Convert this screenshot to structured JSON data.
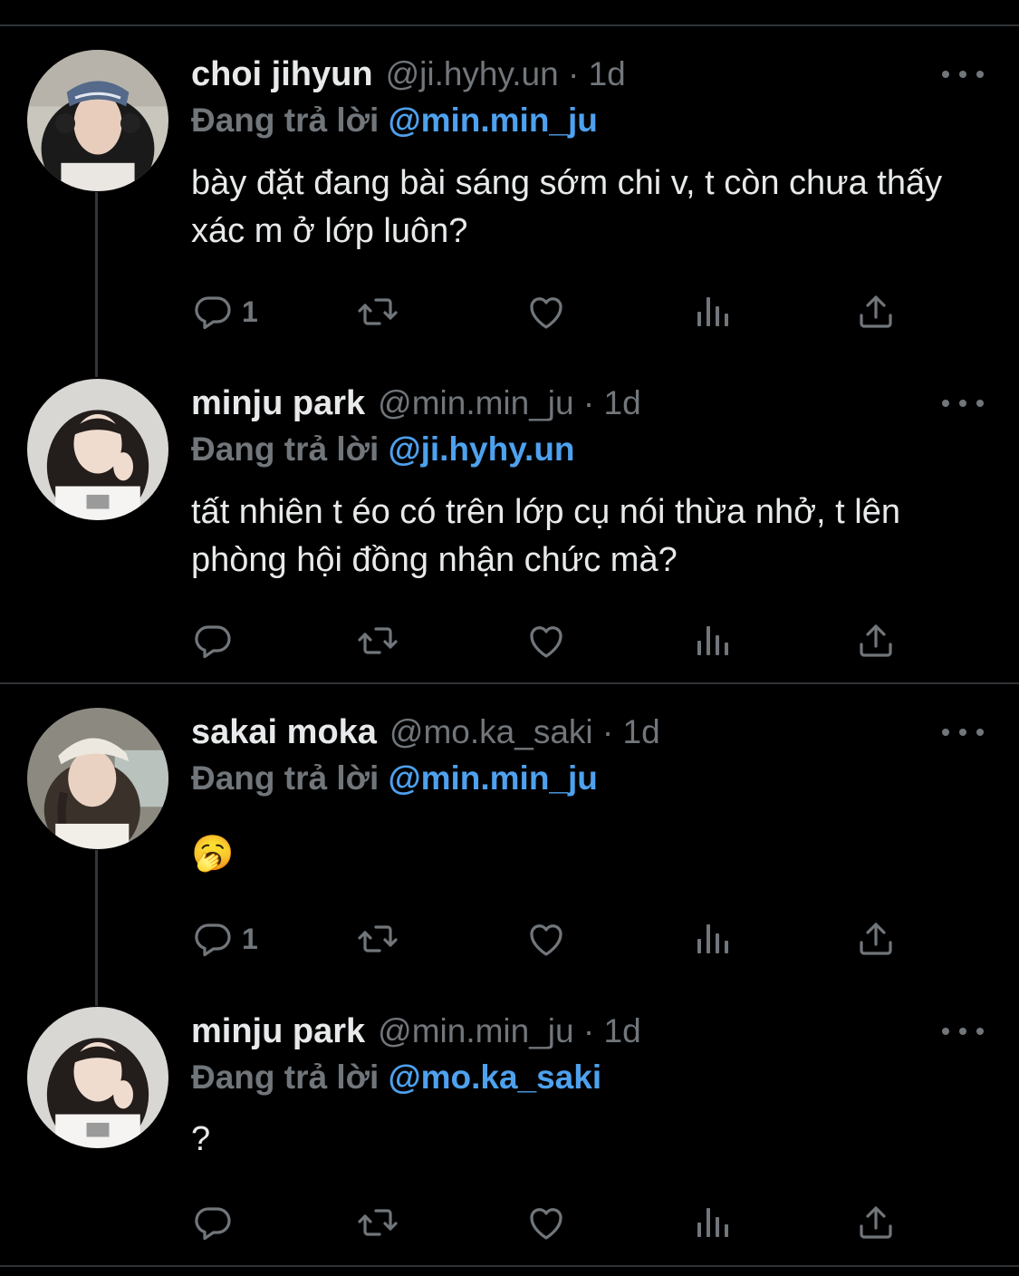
{
  "reply_prefix": "Đang trả lời",
  "tweets": [
    {
      "name": "choi jihyun",
      "handle": "@ji.hyhy.un · 1d",
      "reply_to": "@min.min_ju",
      "text": "bày đặt đang bài sáng sớm chi v, t còn chưa thấy xác m ở lớp luôn?",
      "reply_count": "1",
      "avatar": "avatar-woman-headphones-bandana"
    },
    {
      "name": "minju park",
      "handle": "@min.min_ju · 1d",
      "reply_to": "@ji.hyhy.un",
      "text": "tất nhiên t éo có trên lớp cụ nói thừa nhở, t lên phòng hội đồng nhận chức mà?",
      "reply_count": "",
      "avatar": "avatar-woman-white-top"
    },
    {
      "name": "sakai moka",
      "handle": "@mo.ka_saki · 1d",
      "reply_to": "@min.min_ju",
      "text": "🥱",
      "reply_count": "1",
      "avatar": "avatar-woman-cap-braid"
    },
    {
      "name": "minju park",
      "handle": "@min.min_ju · 1d",
      "reply_to": "@mo.ka_saki",
      "text": "?",
      "reply_count": "",
      "avatar": "avatar-woman-white-top"
    }
  ],
  "icons": [
    "reply-icon",
    "retweet-icon",
    "like-icon",
    "views-icon",
    "share-icon",
    "more-icon"
  ],
  "colors": {
    "background": "#000000",
    "text": "#e7e9ea",
    "muted": "#71767b",
    "mention": "#4ea1ee",
    "divider": "#2f3336"
  }
}
